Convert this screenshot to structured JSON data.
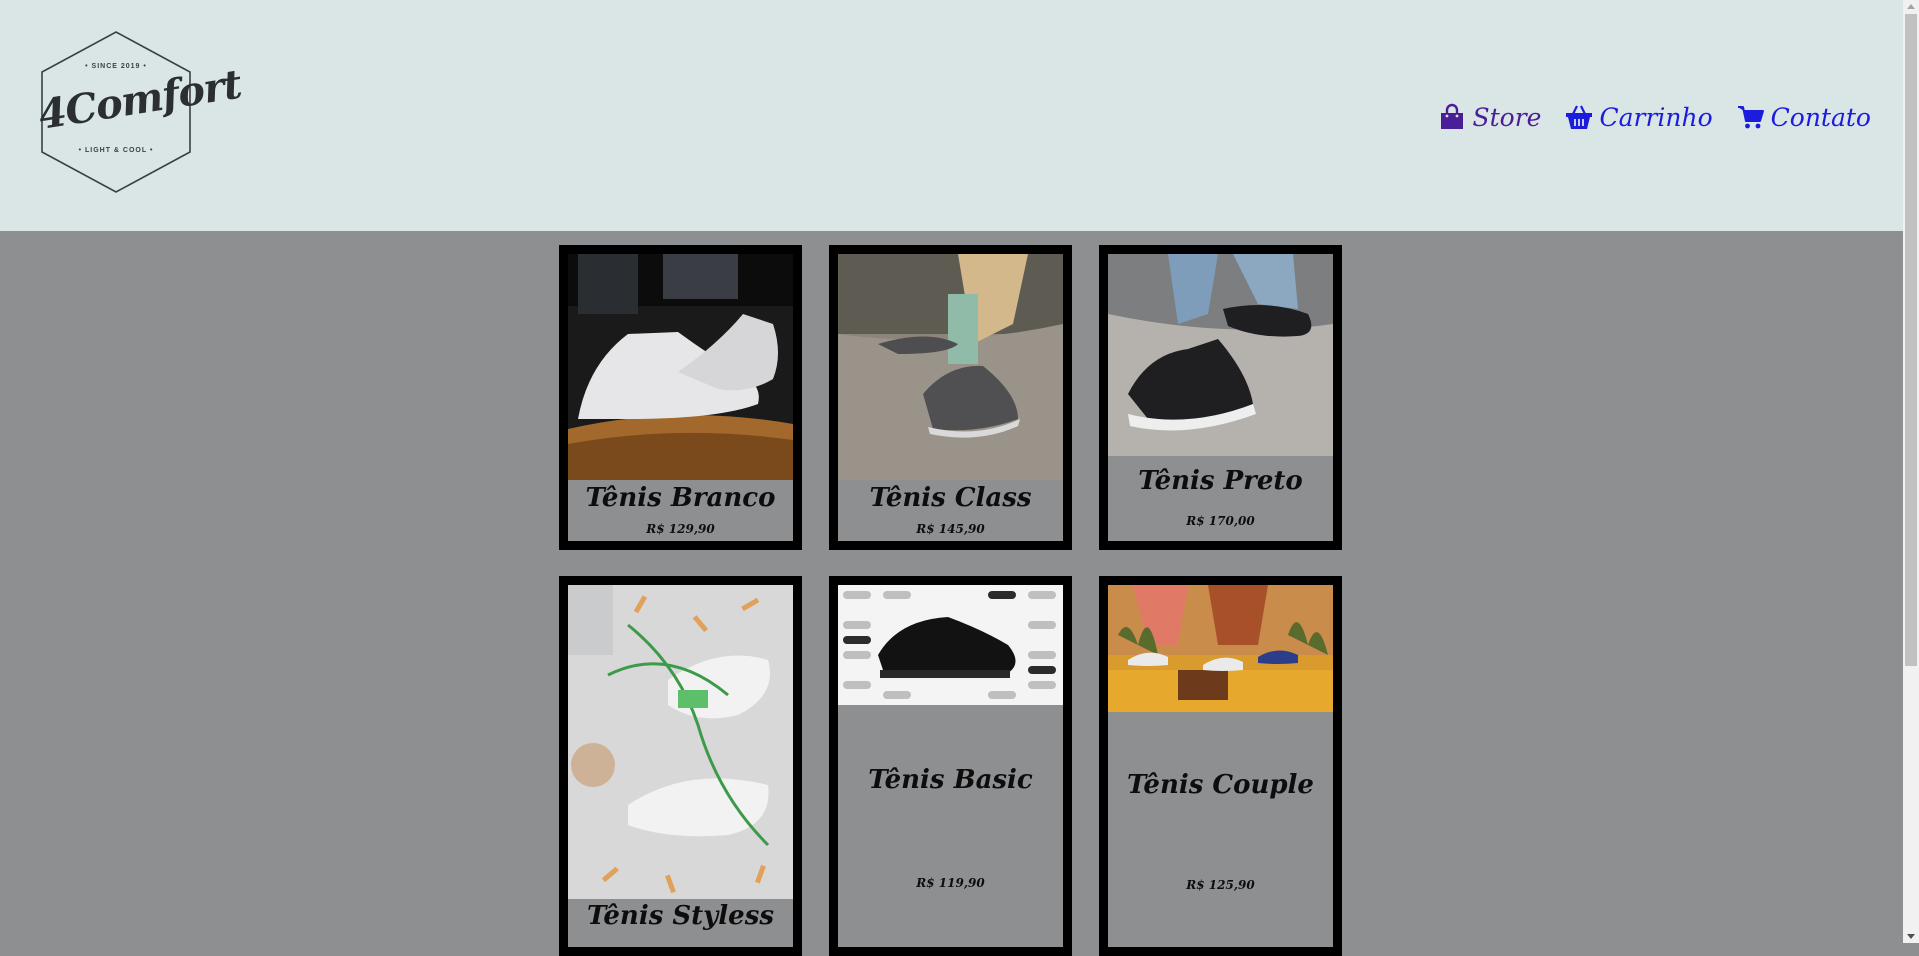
{
  "header": {
    "logo": {
      "since": "• SINCE 2019 •",
      "brand": "4Comfort",
      "tagline": "• LIGHT & COOL •"
    },
    "nav": [
      {
        "label": "Store",
        "icon": "shopping-bag-icon",
        "color": "#4a1e96"
      },
      {
        "label": "Carrinho",
        "icon": "basket-icon",
        "color": "#1c1cde"
      },
      {
        "label": "Contato",
        "icon": "cart-icon",
        "color": "#1c1cde"
      }
    ]
  },
  "products": [
    {
      "name": "Tênis Branco",
      "price": "R$ 129,90"
    },
    {
      "name": "Tênis Class",
      "price": "R$ 145,90"
    },
    {
      "name": "Tênis Preto",
      "price": "R$ 170,00"
    },
    {
      "name": "Tênis Styless",
      "price": ""
    },
    {
      "name": "Tênis Basic",
      "price": "R$ 119,90"
    },
    {
      "name": "Tênis Couple",
      "price": "R$ 125,90"
    }
  ],
  "colors": {
    "header_bg": "#dae5e6",
    "page_bg": "#8e8f91",
    "card_border": "#000000",
    "nav_link": "#1c1cde",
    "nav_active": "#4a1e96"
  }
}
